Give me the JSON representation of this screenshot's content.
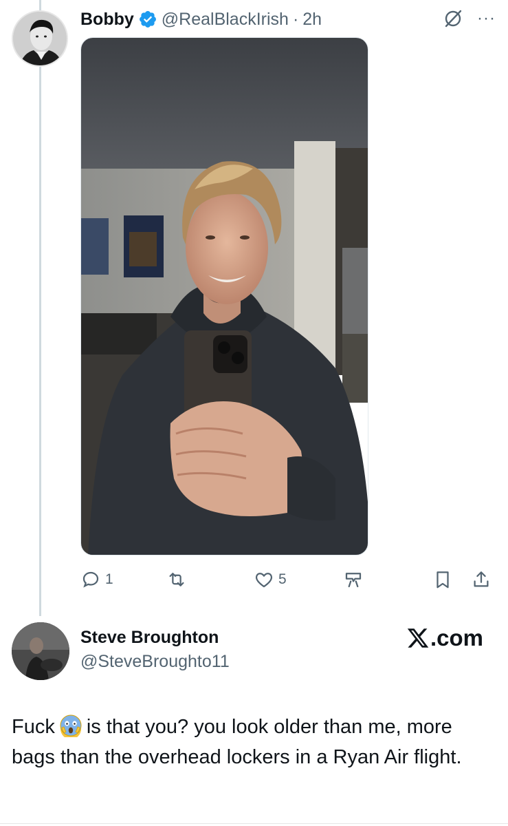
{
  "tweet": {
    "author_name": "Bobby",
    "handle": "@RealBlackIrish",
    "separator": "·",
    "time": "2h",
    "stats": {
      "replies": "1",
      "reposts": "",
      "likes": "5"
    }
  },
  "reply": {
    "author_name": "Steve Broughton",
    "handle": "@SteveBroughto11",
    "text_before_emoji": "Fuck",
    "text_after_emoji": "is that you? you look older than me, more bags than the overhead lockers in a Ryan Air flight."
  },
  "watermark": {
    "text": ".com"
  },
  "icons": {
    "verified": "verified-badge-icon",
    "grok": "grok-icon",
    "more": "more-icon",
    "reply": "reply-icon",
    "repost": "repost-icon",
    "like": "heart-icon",
    "grok_action": "grok-action-icon",
    "bookmark": "bookmark-icon",
    "share": "share-icon",
    "emoji": "screaming-face-emoji"
  },
  "colors": {
    "verified": "#1d9bf0",
    "text_primary": "#0f1419",
    "text_secondary": "#536471",
    "thread_line": "#cfd9de"
  }
}
